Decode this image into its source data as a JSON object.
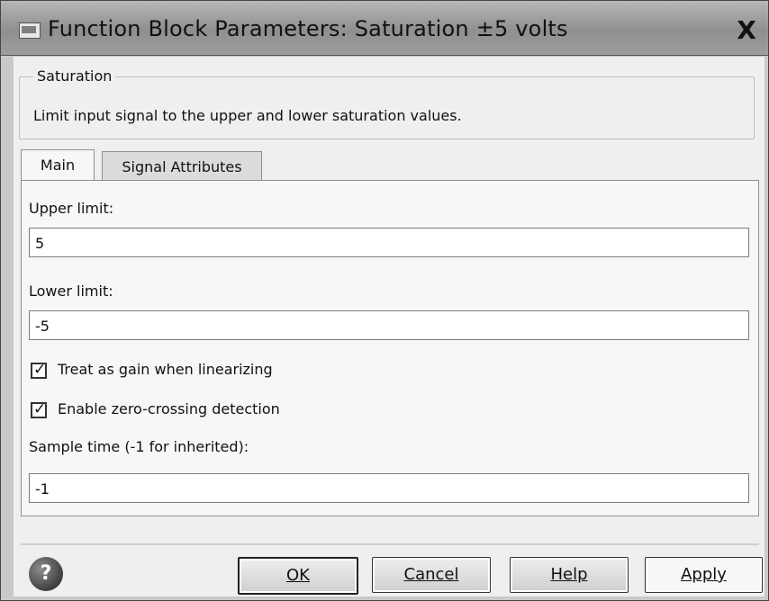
{
  "window": {
    "title": "Function Block Parameters: Saturation ±5 volts",
    "close_label": "X"
  },
  "group": {
    "legend": "Saturation",
    "description": "Limit input signal to the upper and lower saturation values."
  },
  "tabs": [
    {
      "label": "Main",
      "active": true
    },
    {
      "label": "Signal Attributes",
      "active": false
    }
  ],
  "fields": {
    "upper_limit_label": "Upper limit:",
    "upper_limit_value": "5",
    "lower_limit_label": "Lower limit:",
    "lower_limit_value": "-5",
    "sample_time_label": "Sample time (-1 for inherited):",
    "sample_time_value": "-1"
  },
  "checkboxes": [
    {
      "label": "Treat as gain when linearizing",
      "checked": true
    },
    {
      "label": "Enable zero-crossing detection",
      "checked": true
    }
  ],
  "buttons": {
    "ok": "OK",
    "cancel": "Cancel",
    "help": "Help",
    "apply": "Apply"
  },
  "icons": {
    "app": "dialog-icon",
    "close": "close-icon",
    "help": "help-icon"
  }
}
